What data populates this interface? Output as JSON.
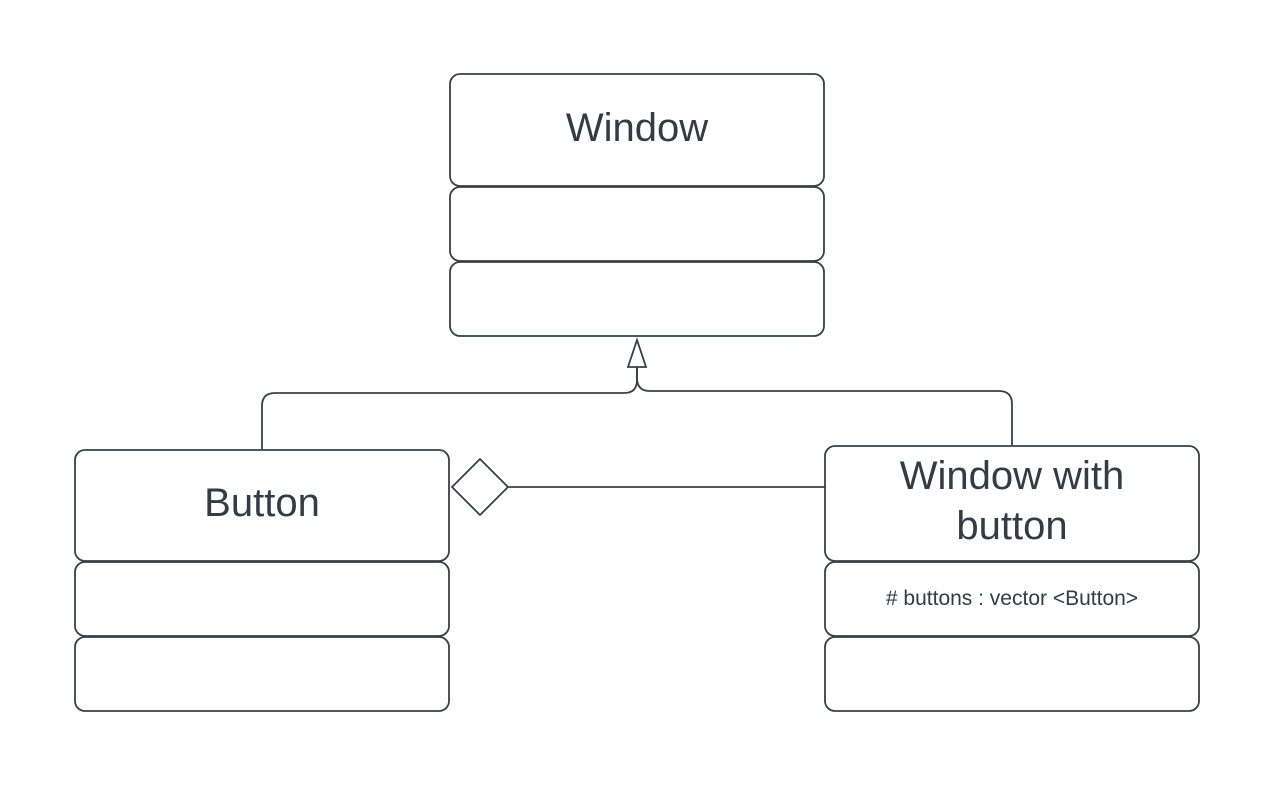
{
  "diagram": {
    "type": "UML class diagram",
    "classes": [
      {
        "id": "window",
        "name": [
          "Window"
        ],
        "attributes": [],
        "methods": []
      },
      {
        "id": "button",
        "name": [
          "Button"
        ],
        "attributes": [],
        "methods": []
      },
      {
        "id": "window-with-button",
        "name": [
          "Window with",
          "button"
        ],
        "attributes": [
          "# buttons : vector <Button>"
        ],
        "methods": []
      }
    ],
    "relationships": [
      {
        "type": "generalization",
        "from": "button",
        "to": "window"
      },
      {
        "type": "generalization",
        "from": "window-with-button",
        "to": "window"
      },
      {
        "type": "aggregation",
        "whole": "button",
        "part": "window-with-button"
      }
    ]
  },
  "colors": {
    "stroke": "#3a3f47",
    "text": "#333b45",
    "background": "#ffffff"
  }
}
